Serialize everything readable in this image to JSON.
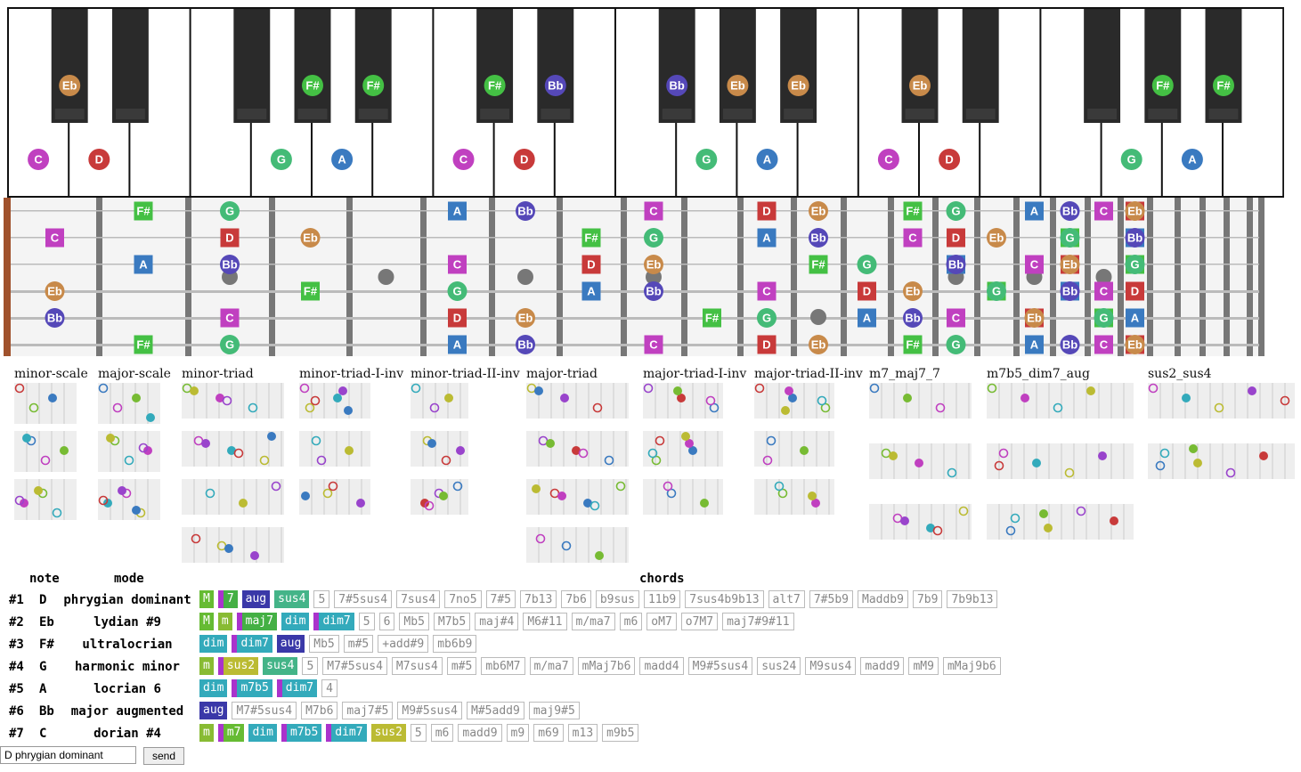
{
  "colors": {
    "C": "#c040c0",
    "D": "#c83a3a",
    "Eb": "#c88a4a",
    "F#": "#44c044",
    "G": "#44bb77",
    "A": "#3a7ac0",
    "Bb": "#5548b8",
    "M": "#66bb33",
    "m": "#88bb33",
    "aug": "#3a38a8",
    "sus": "#44b488",
    "dim": "#33aabb",
    "dim7": "#33aabb",
    "maj7": "#44b044",
    "7": "#44b044",
    "m7": "#66bb33",
    "m7b5": "#33aabb",
    "sus2": "#bbbb33"
  },
  "piano": {
    "white_notes": [
      "C",
      "D",
      "",
      "",
      "G",
      "A",
      "",
      "C",
      "D",
      "",
      "",
      "G",
      "A",
      "",
      "C",
      "D",
      "",
      "",
      "G",
      "A",
      ""
    ],
    "black_notes": [
      "Eb",
      "",
      "F#",
      "Bb",
      "Eb",
      "",
      "F#",
      "Bb",
      "Eb",
      "",
      "F#",
      "Bb"
    ]
  },
  "fretboard": {
    "rows": [
      [
        [
          "F#",
          2
        ],
        [
          "G",
          3
        ],
        [
          "A",
          6
        ],
        [
          "Bb",
          7
        ],
        [
          "C",
          9
        ],
        [
          "D",
          11
        ],
        [
          "Eb",
          12
        ],
        [
          "F#",
          14
        ],
        [
          "G",
          15
        ],
        [
          "A",
          17
        ],
        [
          "Bb",
          18
        ],
        [
          "C",
          19
        ],
        [
          "D",
          20
        ],
        [
          "Eb",
          20
        ]
      ],
      [
        [
          "C",
          1
        ],
        [
          "D",
          3
        ],
        [
          "Eb",
          4
        ],
        [
          "F#",
          8
        ],
        [
          "G",
          9
        ],
        [
          "A",
          11
        ],
        [
          "Bb",
          12
        ],
        [
          "C",
          14
        ],
        [
          "D",
          15
        ],
        [
          "Eb",
          16
        ],
        [
          "F#",
          18
        ],
        [
          "G",
          18
        ],
        [
          "A",
          20
        ],
        [
          "Bb",
          20
        ]
      ],
      [
        [
          "A",
          2
        ],
        [
          "Bb",
          3
        ],
        [
          "C",
          6
        ],
        [
          "D",
          8
        ],
        [
          "Eb",
          9
        ],
        [
          "F#",
          12
        ],
        [
          "G",
          13
        ],
        [
          "A",
          15
        ],
        [
          "Bb",
          15
        ],
        [
          "C",
          17
        ],
        [
          "D",
          18
        ],
        [
          "Eb",
          18
        ],
        [
          "F#",
          20
        ],
        [
          "G",
          20
        ]
      ],
      [
        [
          "Eb",
          1
        ],
        [
          "F#",
          4
        ],
        [
          "G",
          6
        ],
        [
          "A",
          8
        ],
        [
          "Bb",
          9
        ],
        [
          "C",
          11
        ],
        [
          "D",
          13
        ],
        [
          "Eb",
          14
        ],
        [
          "F#",
          16
        ],
        [
          "G",
          16
        ],
        [
          "A",
          18
        ],
        [
          "Bb",
          18
        ],
        [
          "C",
          19
        ],
        [
          "D",
          20
        ]
      ],
      [
        [
          "Bb",
          1
        ],
        [
          "C",
          3
        ],
        [
          "D",
          6
        ],
        [
          "Eb",
          7
        ],
        [
          "F#",
          10
        ],
        [
          "G",
          11
        ],
        [
          "A",
          13
        ],
        [
          "Bb",
          14
        ],
        [
          "C",
          15
        ],
        [
          "D",
          17
        ],
        [
          "Eb",
          17
        ],
        [
          "F#",
          19
        ],
        [
          "G",
          19
        ],
        [
          "A",
          20
        ]
      ],
      [
        [
          "F#",
          2
        ],
        [
          "G",
          3
        ],
        [
          "A",
          6
        ],
        [
          "Bb",
          7
        ],
        [
          "C",
          9
        ],
        [
          "D",
          11
        ],
        [
          "Eb",
          12
        ],
        [
          "F#",
          14
        ],
        [
          "G",
          15
        ],
        [
          "A",
          17
        ],
        [
          "Bb",
          18
        ],
        [
          "C",
          19
        ],
        [
          "D",
          20
        ],
        [
          "Eb",
          20
        ]
      ]
    ]
  },
  "diagram_titles": [
    "minor-scale",
    "major-scale",
    "minor-triad",
    "minor-triad-I-inv",
    "minor-triad-II-inv",
    "major-triad",
    "major-triad-I-inv",
    "major-triad-II-inv",
    "m7_maj7_7",
    "m7b5_dim7_aug",
    "sus2_sus4"
  ],
  "table": {
    "headers": {
      "note": "note",
      "mode": "mode",
      "chords": "chords"
    },
    "rows": [
      {
        "num": "#1",
        "note": "D",
        "mode": "phrygian dominant",
        "chips": [
          [
            "M",
            "c",
            "M"
          ],
          [
            "7",
            "c2",
            "7"
          ],
          [
            "aug",
            "c",
            "aug"
          ],
          [
            "sus4",
            "c",
            "sus"
          ],
          [
            "5",
            "o"
          ],
          [
            "7#5sus4",
            "o"
          ],
          [
            "7sus4",
            "o"
          ],
          [
            "7no5",
            "o"
          ],
          [
            "7#5",
            "o"
          ],
          [
            "7b13",
            "o"
          ],
          [
            "7b6",
            "o"
          ],
          [
            "b9sus",
            "o"
          ],
          [
            "11b9",
            "o"
          ],
          [
            "7sus4b9b13",
            "o"
          ],
          [
            "alt7",
            "o"
          ],
          [
            "7#5b9",
            "o"
          ],
          [
            "Maddb9",
            "o"
          ],
          [
            "7b9",
            "o"
          ],
          [
            "7b9b13",
            "o"
          ]
        ]
      },
      {
        "num": "#2",
        "note": "Eb",
        "mode": "lydian #9",
        "chips": [
          [
            "M",
            "c",
            "M"
          ],
          [
            "m",
            "c",
            "m"
          ],
          [
            "maj7",
            "c2",
            "maj7"
          ],
          [
            "dim",
            "c",
            "dim"
          ],
          [
            "dim7",
            "c2",
            "dim7"
          ],
          [
            "5",
            "o"
          ],
          [
            "6",
            "o"
          ],
          [
            "Mb5",
            "o"
          ],
          [
            "M7b5",
            "o"
          ],
          [
            "maj#4",
            "o"
          ],
          [
            "M6#11",
            "o"
          ],
          [
            "m/ma7",
            "o"
          ],
          [
            "m6",
            "o"
          ],
          [
            "oM7",
            "o"
          ],
          [
            "o7M7",
            "o"
          ],
          [
            "maj7#9#11",
            "o"
          ]
        ]
      },
      {
        "num": "#3",
        "note": "F#",
        "mode": "ultralocrian",
        "chips": [
          [
            "dim",
            "c",
            "dim"
          ],
          [
            "dim7",
            "c2",
            "dim7"
          ],
          [
            "aug",
            "c",
            "aug"
          ],
          [
            "Mb5",
            "o"
          ],
          [
            "m#5",
            "o"
          ],
          [
            "+add#9",
            "o"
          ],
          [
            "mb6b9",
            "o"
          ]
        ]
      },
      {
        "num": "#4",
        "note": "G",
        "mode": "harmonic minor",
        "chips": [
          [
            "m",
            "c",
            "m"
          ],
          [
            "sus2",
            "c2",
            "sus2"
          ],
          [
            "sus4",
            "c",
            "sus"
          ],
          [
            "5",
            "o"
          ],
          [
            "M7#5sus4",
            "o"
          ],
          [
            "M7sus4",
            "o"
          ],
          [
            "m#5",
            "o"
          ],
          [
            "mb6M7",
            "o"
          ],
          [
            "m/ma7",
            "o"
          ],
          [
            "mMaj7b6",
            "o"
          ],
          [
            "madd4",
            "o"
          ],
          [
            "M9#5sus4",
            "o"
          ],
          [
            "sus24",
            "o"
          ],
          [
            "M9sus4",
            "o"
          ],
          [
            "madd9",
            "o"
          ],
          [
            "mM9",
            "o"
          ],
          [
            "mMaj9b6",
            "o"
          ]
        ]
      },
      {
        "num": "#5",
        "note": "A",
        "mode": "locrian 6",
        "chips": [
          [
            "dim",
            "c",
            "dim"
          ],
          [
            "m7b5",
            "c2",
            "m7b5"
          ],
          [
            "dim7",
            "c2",
            "dim7"
          ],
          [
            "4",
            "o"
          ]
        ]
      },
      {
        "num": "#6",
        "note": "Bb",
        "mode": "major augmented",
        "chips": [
          [
            "aug",
            "c",
            "aug"
          ],
          [
            "M7#5sus4",
            "o"
          ],
          [
            "M7b6",
            "o"
          ],
          [
            "maj7#5",
            "o"
          ],
          [
            "M9#5sus4",
            "o"
          ],
          [
            "M#5add9",
            "o"
          ],
          [
            "maj9#5",
            "o"
          ]
        ]
      },
      {
        "num": "#7",
        "note": "C",
        "mode": "dorian #4",
        "chips": [
          [
            "m",
            "c",
            "m"
          ],
          [
            "m7",
            "c2",
            "m7"
          ],
          [
            "dim",
            "c",
            "dim"
          ],
          [
            "m7b5",
            "c2",
            "m7b5"
          ],
          [
            "dim7",
            "c2",
            "dim7"
          ],
          [
            "sus2",
            "c",
            "sus2"
          ],
          [
            "5",
            "o"
          ],
          [
            "m6",
            "o"
          ],
          [
            "madd9",
            "o"
          ],
          [
            "m9",
            "o"
          ],
          [
            "m69",
            "o"
          ],
          [
            "m13",
            "o"
          ],
          [
            "m9b5",
            "o"
          ]
        ]
      }
    ]
  },
  "input": {
    "value": "D phrygian dominant"
  },
  "send_label": "send"
}
